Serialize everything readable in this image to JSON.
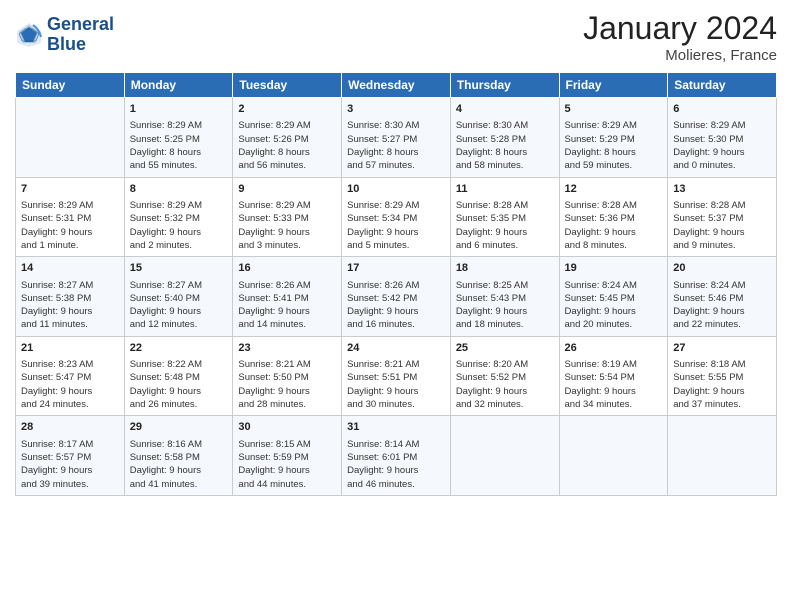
{
  "header": {
    "logo_line1": "General",
    "logo_line2": "Blue",
    "title": "January 2024",
    "location": "Molieres, France"
  },
  "columns": [
    "Sunday",
    "Monday",
    "Tuesday",
    "Wednesday",
    "Thursday",
    "Friday",
    "Saturday"
  ],
  "rows": [
    [
      {
        "day": "",
        "lines": []
      },
      {
        "day": "1",
        "lines": [
          "Sunrise: 8:29 AM",
          "Sunset: 5:25 PM",
          "Daylight: 8 hours",
          "and 55 minutes."
        ]
      },
      {
        "day": "2",
        "lines": [
          "Sunrise: 8:29 AM",
          "Sunset: 5:26 PM",
          "Daylight: 8 hours",
          "and 56 minutes."
        ]
      },
      {
        "day": "3",
        "lines": [
          "Sunrise: 8:30 AM",
          "Sunset: 5:27 PM",
          "Daylight: 8 hours",
          "and 57 minutes."
        ]
      },
      {
        "day": "4",
        "lines": [
          "Sunrise: 8:30 AM",
          "Sunset: 5:28 PM",
          "Daylight: 8 hours",
          "and 58 minutes."
        ]
      },
      {
        "day": "5",
        "lines": [
          "Sunrise: 8:29 AM",
          "Sunset: 5:29 PM",
          "Daylight: 8 hours",
          "and 59 minutes."
        ]
      },
      {
        "day": "6",
        "lines": [
          "Sunrise: 8:29 AM",
          "Sunset: 5:30 PM",
          "Daylight: 9 hours",
          "and 0 minutes."
        ]
      }
    ],
    [
      {
        "day": "7",
        "lines": [
          "Sunrise: 8:29 AM",
          "Sunset: 5:31 PM",
          "Daylight: 9 hours",
          "and 1 minute."
        ]
      },
      {
        "day": "8",
        "lines": [
          "Sunrise: 8:29 AM",
          "Sunset: 5:32 PM",
          "Daylight: 9 hours",
          "and 2 minutes."
        ]
      },
      {
        "day": "9",
        "lines": [
          "Sunrise: 8:29 AM",
          "Sunset: 5:33 PM",
          "Daylight: 9 hours",
          "and 3 minutes."
        ]
      },
      {
        "day": "10",
        "lines": [
          "Sunrise: 8:29 AM",
          "Sunset: 5:34 PM",
          "Daylight: 9 hours",
          "and 5 minutes."
        ]
      },
      {
        "day": "11",
        "lines": [
          "Sunrise: 8:28 AM",
          "Sunset: 5:35 PM",
          "Daylight: 9 hours",
          "and 6 minutes."
        ]
      },
      {
        "day": "12",
        "lines": [
          "Sunrise: 8:28 AM",
          "Sunset: 5:36 PM",
          "Daylight: 9 hours",
          "and 8 minutes."
        ]
      },
      {
        "day": "13",
        "lines": [
          "Sunrise: 8:28 AM",
          "Sunset: 5:37 PM",
          "Daylight: 9 hours",
          "and 9 minutes."
        ]
      }
    ],
    [
      {
        "day": "14",
        "lines": [
          "Sunrise: 8:27 AM",
          "Sunset: 5:38 PM",
          "Daylight: 9 hours",
          "and 11 minutes."
        ]
      },
      {
        "day": "15",
        "lines": [
          "Sunrise: 8:27 AM",
          "Sunset: 5:40 PM",
          "Daylight: 9 hours",
          "and 12 minutes."
        ]
      },
      {
        "day": "16",
        "lines": [
          "Sunrise: 8:26 AM",
          "Sunset: 5:41 PM",
          "Daylight: 9 hours",
          "and 14 minutes."
        ]
      },
      {
        "day": "17",
        "lines": [
          "Sunrise: 8:26 AM",
          "Sunset: 5:42 PM",
          "Daylight: 9 hours",
          "and 16 minutes."
        ]
      },
      {
        "day": "18",
        "lines": [
          "Sunrise: 8:25 AM",
          "Sunset: 5:43 PM",
          "Daylight: 9 hours",
          "and 18 minutes."
        ]
      },
      {
        "day": "19",
        "lines": [
          "Sunrise: 8:24 AM",
          "Sunset: 5:45 PM",
          "Daylight: 9 hours",
          "and 20 minutes."
        ]
      },
      {
        "day": "20",
        "lines": [
          "Sunrise: 8:24 AM",
          "Sunset: 5:46 PM",
          "Daylight: 9 hours",
          "and 22 minutes."
        ]
      }
    ],
    [
      {
        "day": "21",
        "lines": [
          "Sunrise: 8:23 AM",
          "Sunset: 5:47 PM",
          "Daylight: 9 hours",
          "and 24 minutes."
        ]
      },
      {
        "day": "22",
        "lines": [
          "Sunrise: 8:22 AM",
          "Sunset: 5:48 PM",
          "Daylight: 9 hours",
          "and 26 minutes."
        ]
      },
      {
        "day": "23",
        "lines": [
          "Sunrise: 8:21 AM",
          "Sunset: 5:50 PM",
          "Daylight: 9 hours",
          "and 28 minutes."
        ]
      },
      {
        "day": "24",
        "lines": [
          "Sunrise: 8:21 AM",
          "Sunset: 5:51 PM",
          "Daylight: 9 hours",
          "and 30 minutes."
        ]
      },
      {
        "day": "25",
        "lines": [
          "Sunrise: 8:20 AM",
          "Sunset: 5:52 PM",
          "Daylight: 9 hours",
          "and 32 minutes."
        ]
      },
      {
        "day": "26",
        "lines": [
          "Sunrise: 8:19 AM",
          "Sunset: 5:54 PM",
          "Daylight: 9 hours",
          "and 34 minutes."
        ]
      },
      {
        "day": "27",
        "lines": [
          "Sunrise: 8:18 AM",
          "Sunset: 5:55 PM",
          "Daylight: 9 hours",
          "and 37 minutes."
        ]
      }
    ],
    [
      {
        "day": "28",
        "lines": [
          "Sunrise: 8:17 AM",
          "Sunset: 5:57 PM",
          "Daylight: 9 hours",
          "and 39 minutes."
        ]
      },
      {
        "day": "29",
        "lines": [
          "Sunrise: 8:16 AM",
          "Sunset: 5:58 PM",
          "Daylight: 9 hours",
          "and 41 minutes."
        ]
      },
      {
        "day": "30",
        "lines": [
          "Sunrise: 8:15 AM",
          "Sunset: 5:59 PM",
          "Daylight: 9 hours",
          "and 44 minutes."
        ]
      },
      {
        "day": "31",
        "lines": [
          "Sunrise: 8:14 AM",
          "Sunset: 6:01 PM",
          "Daylight: 9 hours",
          "and 46 minutes."
        ]
      },
      {
        "day": "",
        "lines": []
      },
      {
        "day": "",
        "lines": []
      },
      {
        "day": "",
        "lines": []
      }
    ]
  ]
}
